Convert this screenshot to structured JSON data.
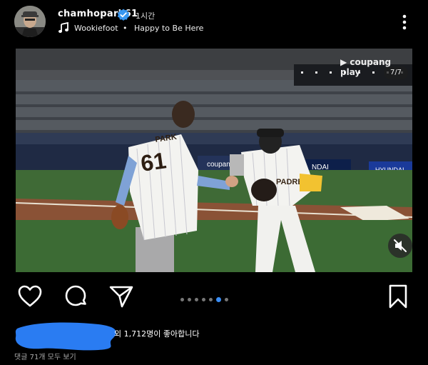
{
  "post": {
    "username": "chamhopark61",
    "time": "1시간",
    "music": {
      "artist": "Wookiefoot",
      "separator": "•",
      "song": "Happy to Be Here"
    }
  },
  "media": {
    "watermark": "▶ coupang play",
    "counter": "7/7",
    "jersey_name": "PARK",
    "jersey_number": "61",
    "ad_coupang": "coupang",
    "ad_ndai": "NDAI",
    "ad_hyundai": "HYUNDAI",
    "jersey_front": "PADRES"
  },
  "carousel": {
    "total": 7,
    "active": 6
  },
  "likes": {
    "text": "외 1,712명이 좋아합니다"
  },
  "comments": {
    "text": "댓글 71개 모두 보기"
  },
  "colors": {
    "accent": "#3a8ef6",
    "verified": "#3897f0"
  },
  "icons": [
    "verified-icon",
    "music-icon",
    "more-icon",
    "heart-icon",
    "comment-icon",
    "share-icon",
    "bookmark-icon",
    "mute-icon"
  ]
}
